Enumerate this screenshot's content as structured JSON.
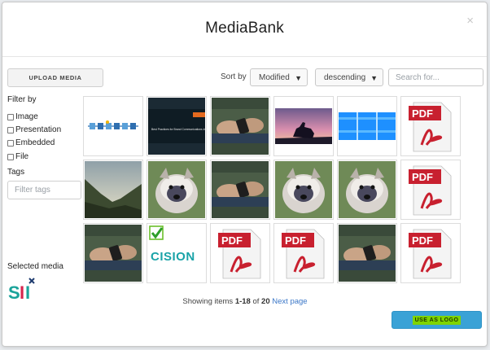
{
  "modal": {
    "title": "MediaBank",
    "close_glyph": "×"
  },
  "toolbar": {
    "upload_label": "UPLOAD MEDIA",
    "sort_label": "Sort by",
    "sort_field": "Modified",
    "sort_order": "descending",
    "search_placeholder": "Search for..."
  },
  "filters": {
    "title": "Filter by",
    "options": [
      {
        "label": "Image",
        "checked": false
      },
      {
        "label": "Presentation",
        "checked": false
      },
      {
        "label": "Embedded",
        "checked": false
      },
      {
        "label": "File",
        "checked": false
      }
    ],
    "tags_title": "Tags",
    "tags_placeholder": "Filter tags"
  },
  "selected": {
    "title": "Selected media",
    "logo_text": "SII"
  },
  "media": [
    {
      "kind": "timeline-slide"
    },
    {
      "kind": "presentation",
      "text": "Best Practices for Brand Communications in Times of Uncertainty"
    },
    {
      "kind": "photo-phone"
    },
    {
      "kind": "photo-horse-sunset"
    },
    {
      "kind": "blue-grid"
    },
    {
      "kind": "pdf-icon",
      "text": "PDF"
    },
    {
      "kind": "photo-valley"
    },
    {
      "kind": "photo-dog"
    },
    {
      "kind": "photo-phone"
    },
    {
      "kind": "photo-dog"
    },
    {
      "kind": "photo-dog"
    },
    {
      "kind": "pdf-icon",
      "text": "PDF"
    },
    {
      "kind": "photo-phone"
    },
    {
      "kind": "cision-logo",
      "text": "CISION"
    },
    {
      "kind": "pdf-icon",
      "text": "PDF"
    },
    {
      "kind": "pdf-icon",
      "text": "PDF"
    },
    {
      "kind": "photo-phone"
    },
    {
      "kind": "pdf-icon",
      "text": "PDF"
    }
  ],
  "pagination": {
    "prefix": "Showing items ",
    "range": "1-18",
    "of": " of ",
    "total": "20",
    "next_label": "Next page"
  },
  "actions": {
    "use_logo_label": "USE AS LOGO"
  },
  "colors": {
    "accent": "#3aa2d6",
    "highlight": "#7ed400",
    "link": "#3a76c7",
    "pdf_red": "#c8202f"
  }
}
